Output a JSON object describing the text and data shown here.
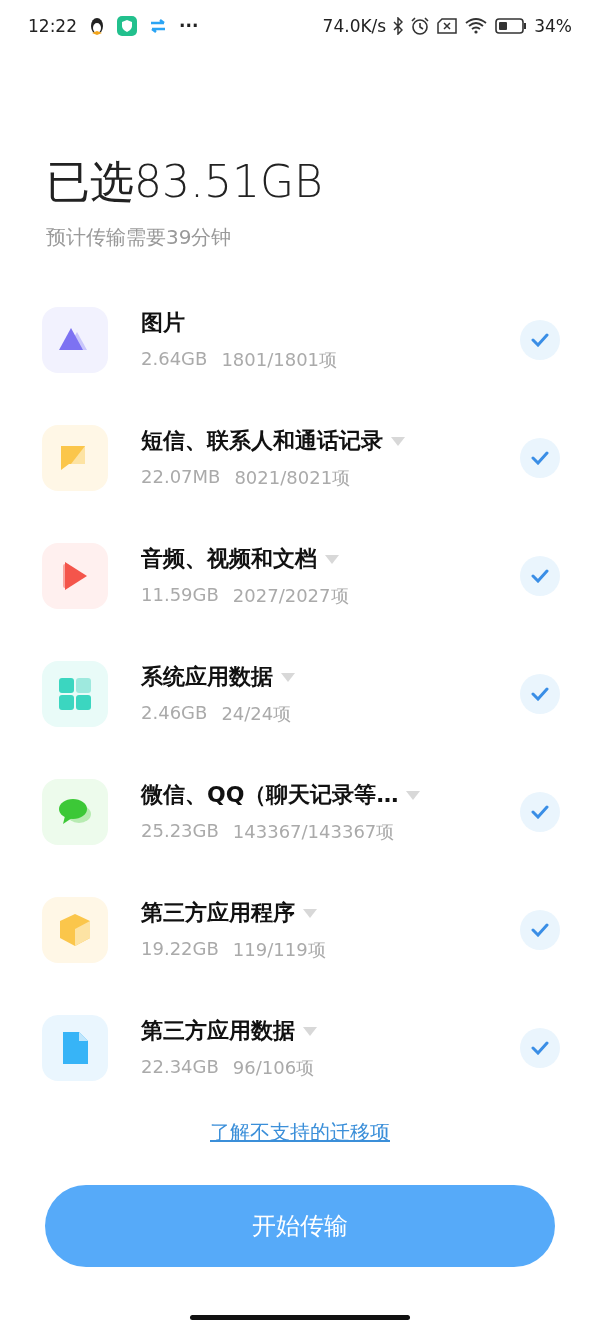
{
  "status_bar": {
    "time": "12:22",
    "more": "···",
    "speed": "74.0K/s",
    "battery": "34%"
  },
  "header": {
    "title": "已选83.51GB",
    "subtitle": "预计传输需要39分钟"
  },
  "items": [
    {
      "kind": "photos",
      "title": "图片",
      "size": "2.64GB",
      "count": "1801/1801项",
      "expandable": false,
      "checked": true
    },
    {
      "kind": "messages",
      "title": "短信、联系人和通话记录",
      "size": "22.07MB",
      "count": "8021/8021项",
      "expandable": true,
      "checked": true
    },
    {
      "kind": "media",
      "title": "音频、视频和文档",
      "size": "11.59GB",
      "count": "2027/2027项",
      "expandable": true,
      "checked": true
    },
    {
      "kind": "system",
      "title": "系统应用数据",
      "size": "2.46GB",
      "count": "24/24项",
      "expandable": true,
      "checked": true
    },
    {
      "kind": "chat",
      "title": "微信、QQ（聊天记录等…",
      "size": "25.23GB",
      "count": "143367/143367项",
      "expandable": true,
      "checked": true
    },
    {
      "kind": "apps",
      "title": "第三方应用程序",
      "size": "19.22GB",
      "count": "119/119项",
      "expandable": true,
      "checked": true
    },
    {
      "kind": "appdata",
      "title": "第三方应用数据",
      "size": "22.34GB",
      "count": "96/106项",
      "expandable": true,
      "checked": true
    }
  ],
  "link": "了解不支持的迁移项",
  "button": "开始传输"
}
